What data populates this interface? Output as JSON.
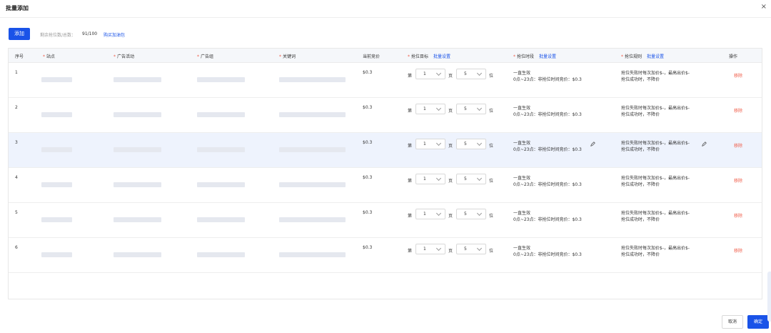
{
  "dialog": {
    "title": "批量添加",
    "close_glyph": "×"
  },
  "toolbar": {
    "add_label": "添加",
    "quota_label": "剩余抢位数/总数：",
    "quota_value": "91/100",
    "buy_link": "购买加油包"
  },
  "table": {
    "headers": {
      "index": "序号",
      "site": "站点",
      "campaign": "广告活动",
      "adgroup": "广告组",
      "keyword": "关键词",
      "current_bid": "当前竞价",
      "target": "抢位目标",
      "target_batch": "批量设置",
      "period": "抢位时段",
      "period_batch": "批量设置",
      "rule": "抢位规则",
      "rule_batch": "批量设置",
      "action": "操作"
    },
    "required_mark": "*",
    "rows": [
      {
        "index": "1",
        "bid": "$0.3",
        "page_prefix": "第",
        "page": "1",
        "page_unit": "页",
        "position": "5",
        "position_unit": "位",
        "period_line1": "一直生效",
        "period_line2": "0点~23点：非抢位时间竞价：$0.3",
        "rule_line1": "抢位失败时每次加价$-，最高出价$-",
        "rule_line2": "抢位成功时，不降价",
        "action": "移除"
      },
      {
        "index": "2",
        "bid": "$0.3",
        "page_prefix": "第",
        "page": "1",
        "page_unit": "页",
        "position": "5",
        "position_unit": "位",
        "period_line1": "一直生效",
        "period_line2": "0点~23点：非抢位时间竞价：$0.3",
        "rule_line1": "抢位失败时每次加价$-，最高出价$-",
        "rule_line2": "抢位成功时，不降价",
        "action": "移除"
      },
      {
        "index": "3",
        "bid": "$0.3",
        "page_prefix": "第",
        "page": "1",
        "page_unit": "页",
        "position": "5",
        "position_unit": "位",
        "period_line1": "一直生效",
        "period_line2": "0点~23点：非抢位时间竞价：$0.3",
        "rule_line1": "抢位失败时每次加价$-，最高出价$-",
        "rule_line2": "抢位成功时，不降价",
        "action": "移除"
      },
      {
        "index": "4",
        "bid": "$0.3",
        "page_prefix": "第",
        "page": "1",
        "page_unit": "页",
        "position": "5",
        "position_unit": "位",
        "period_line1": "一直生效",
        "period_line2": "0点~23点：非抢位时间竞价：$0.3",
        "rule_line1": "抢位失败时每次加价$-，最高出价$-",
        "rule_line2": "抢位成功时，不降价",
        "action": "移除"
      },
      {
        "index": "5",
        "bid": "$0.3",
        "page_prefix": "第",
        "page": "1",
        "page_unit": "页",
        "position": "5",
        "position_unit": "位",
        "period_line1": "一直生效",
        "period_line2": "0点~23点：非抢位时间竞价：$0.3",
        "rule_line1": "抢位失败时每次加价$-，最高出价$-",
        "rule_line2": "抢位成功时，不降价",
        "action": "移除"
      },
      {
        "index": "6",
        "bid": "$0.3",
        "page_prefix": "第",
        "page": "1",
        "page_unit": "页",
        "position": "5",
        "position_unit": "位",
        "period_line1": "一直生效",
        "period_line2": "0点~23点：非抢位时间竞价：$0.3",
        "rule_line1": "抢位失败时每次加价$-，最高出价$-",
        "rule_line2": "抢位成功时，不降价",
        "action": "移除"
      }
    ]
  },
  "footer": {
    "cancel_label": "取消",
    "confirm_label": "确定"
  },
  "colors": {
    "primary": "#1a53e8",
    "danger": "#f05a46",
    "hover_row": "#eef3fd",
    "placeholder": "#e5e8ef"
  }
}
